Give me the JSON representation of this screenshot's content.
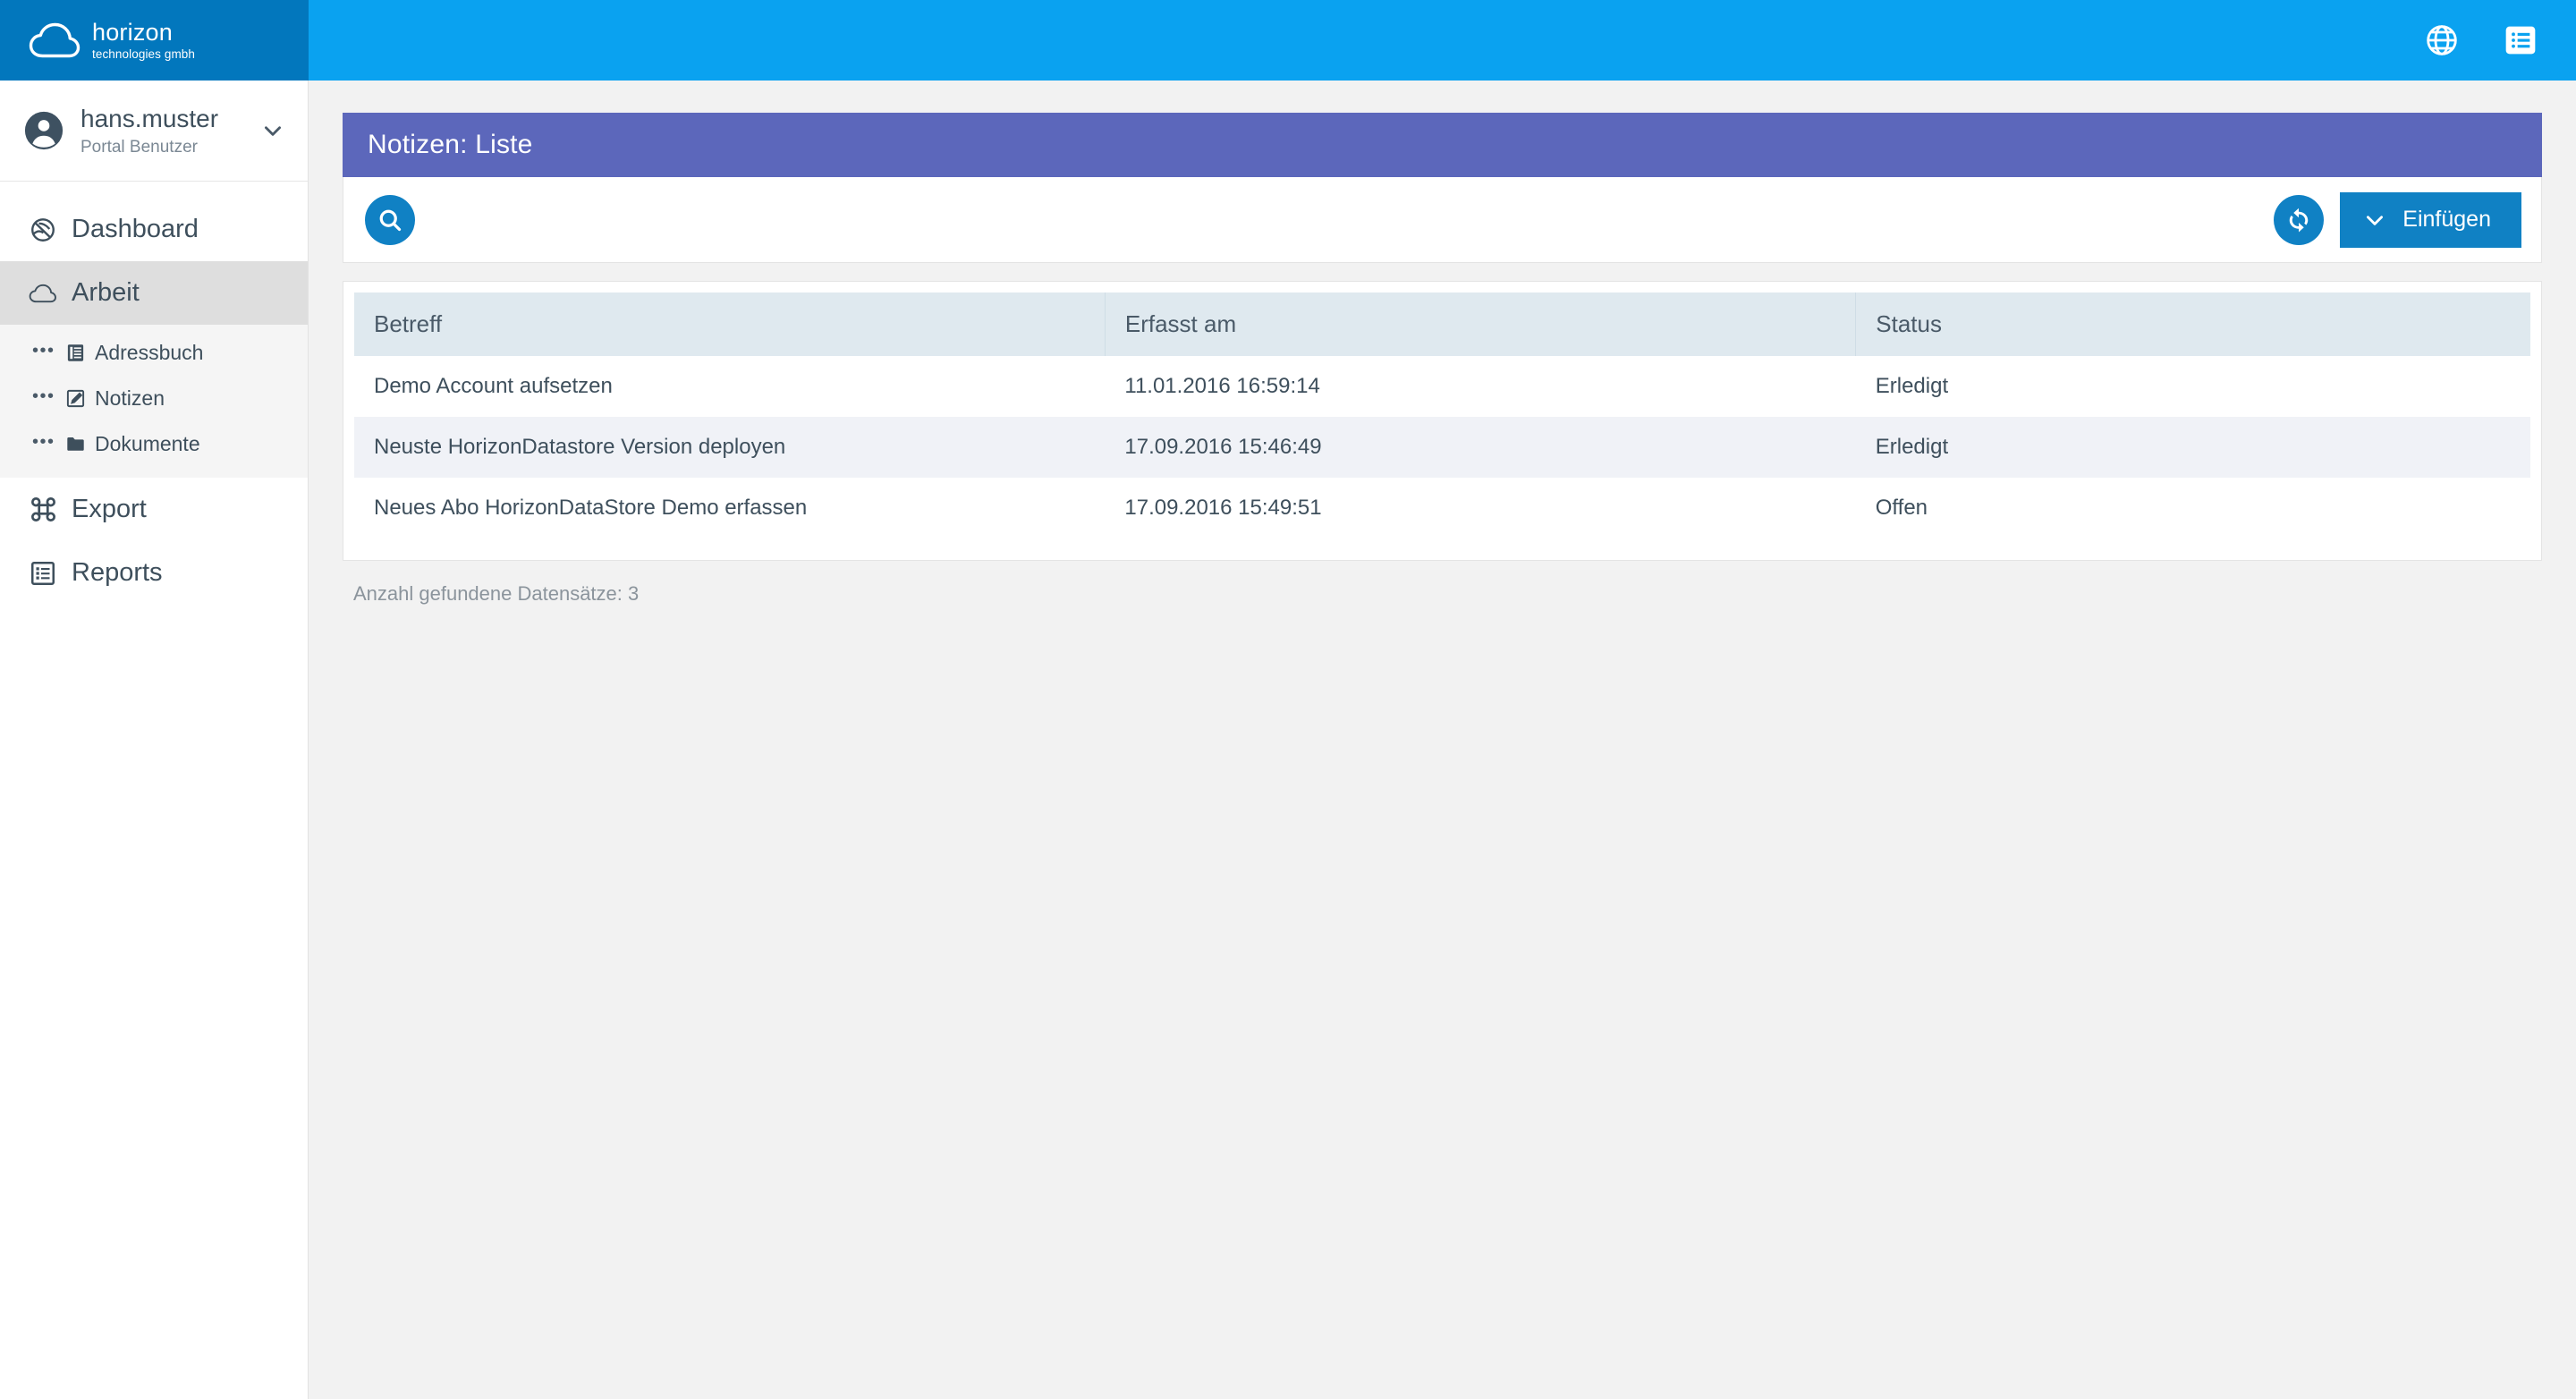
{
  "brand": {
    "name": "horizon",
    "tagline": "technologies gmbh",
    "logo_icon": "cloud-icon",
    "bg_color": "#0277bd"
  },
  "topbar": {
    "bg_color": "#0aa2f0",
    "icons": [
      {
        "name": "globe-icon",
        "label": "Sprache"
      },
      {
        "name": "list-menu-icon",
        "label": "Menü"
      }
    ]
  },
  "sidebar": {
    "user": {
      "name": "hans.muster",
      "role": "Portal Benutzer",
      "avatar_icon": "user-avatar-icon",
      "chevron_icon": "chevron-down-icon"
    },
    "items": [
      {
        "label": "Dashboard",
        "icon": "dashboard-icon",
        "active": false
      },
      {
        "label": "Arbeit",
        "icon": "cloud-icon",
        "active": true
      },
      {
        "label": "Export",
        "icon": "export-icon",
        "active": false
      },
      {
        "label": "Reports",
        "icon": "reports-list-icon",
        "active": false
      }
    ],
    "submenu": [
      {
        "label": "Adressbuch",
        "icon": "address-book-icon",
        "dots": "•••"
      },
      {
        "label": "Notizen",
        "icon": "note-edit-icon",
        "dots": "•••"
      },
      {
        "label": "Dokumente",
        "icon": "folder-icon",
        "dots": "•••"
      }
    ]
  },
  "page": {
    "title": "Notizen: Liste",
    "title_bg_color": "#5c67bb"
  },
  "toolbar": {
    "search_icon": "search-icon",
    "refresh_icon": "refresh-icon",
    "insert_label": "Einfügen",
    "insert_chevron_icon": "chevron-down-icon",
    "accent_color": "#1081c4"
  },
  "table": {
    "columns": [
      "Betreff",
      "Erfasst am",
      "Status"
    ],
    "rows": [
      {
        "betreff": "Demo Account aufsetzen",
        "erfasst_am": "11.01.2016 16:59:14",
        "status": "Erledigt"
      },
      {
        "betreff": "Neuste HorizonDatastore Version deployen",
        "erfasst_am": "17.09.2016 15:46:49",
        "status": "Erledigt"
      },
      {
        "betreff": "Neues Abo HorizonDataStore Demo erfassen",
        "erfasst_am": "17.09.2016 15:49:51",
        "status": "Offen"
      }
    ],
    "header_bg_color": "#dfe9ef",
    "alt_row_color": "#f0f2f7"
  },
  "footer": {
    "count_text": "Anzahl gefundene Datensätze: 3"
  }
}
